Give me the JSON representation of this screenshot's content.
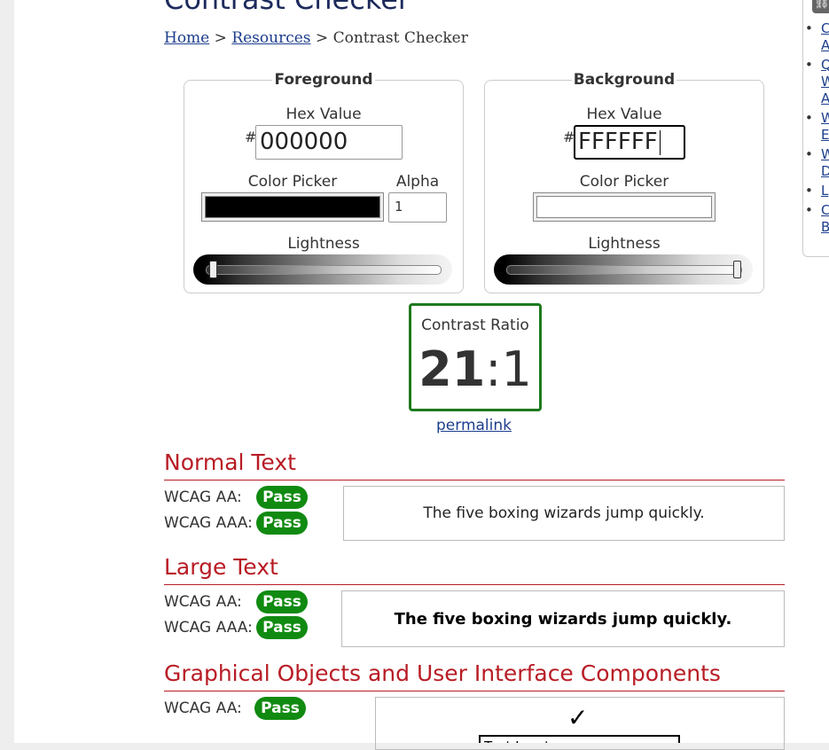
{
  "title": "Contrast Checker",
  "breadcrumb": {
    "home": "Home",
    "sep1": ">",
    "resources": "Resources",
    "sep2": ">",
    "current": "Contrast Checker"
  },
  "foreground": {
    "legend": "Foreground",
    "hex_label": "Hex Value",
    "hash": "#",
    "hex_value": "000000",
    "picker_label": "Color Picker",
    "picker_color": "#000000",
    "alpha_label": "Alpha",
    "alpha_value": "1",
    "lightness_label": "Lightness",
    "lightness": 0
  },
  "background": {
    "legend": "Background",
    "hex_label": "Hex Value",
    "hash": "#",
    "hex_value": "FFFFFF",
    "picker_label": "Color Picker",
    "picker_color": "#FFFFFF",
    "lightness_label": "Lightness",
    "lightness": 100
  },
  "contrast": {
    "label": "Contrast Ratio",
    "ratio_left": "21",
    "ratio_sep": ":",
    "ratio_right": "1",
    "permalink": "permalink"
  },
  "sections": {
    "normal": {
      "heading": "Normal Text",
      "aa_label": "WCAG AA:",
      "aa_result": "Pass",
      "aaa_label": "WCAG AAA:",
      "aaa_result": "Pass",
      "sample": "The five boxing wizards jump quickly."
    },
    "large": {
      "heading": "Large Text",
      "aa_label": "WCAG AA:",
      "aa_result": "Pass",
      "aaa_label": "WCAG AAA:",
      "aaa_result": "Pass",
      "sample": "The five boxing wizards jump quickly."
    },
    "graphical": {
      "heading": "Graphical Objects and User Interface Components",
      "aa_label": "WCAG AA:",
      "aa_result": "Pass",
      "check_mark": "✓",
      "textbox_text": "Text Input"
    }
  },
  "sidebar": {
    "icon": "link-icon",
    "items": [
      {
        "line1": "C",
        "line2": "A"
      },
      {
        "line1": "Q",
        "line2": "W",
        "line3": "A"
      },
      {
        "line1": "W",
        "line2": "E"
      },
      {
        "line1": "W",
        "line2": "D"
      },
      {
        "line1": "L"
      },
      {
        "line1": "C",
        "line2": "B"
      }
    ]
  },
  "colors": {
    "pass_green": "#118a11",
    "heading_red": "#b81c25",
    "title_navy": "#1d2a5c",
    "link_blue": "#1d3e8e",
    "ratio_border": "#1e7a1e"
  }
}
